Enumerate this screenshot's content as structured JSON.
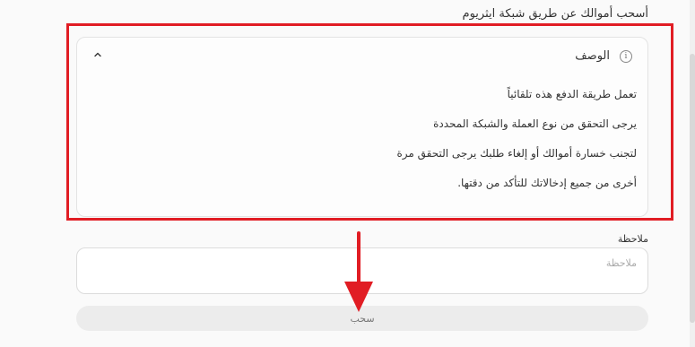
{
  "heading": "أسحب أموالك عن طريق شبكة ايثريوم",
  "description": {
    "title": "الوصف",
    "info_icon": "info-icon",
    "collapse_icon": "chevron-up-icon",
    "lines": [
      "تعمل طريقة الدفع هذه تلقائياً",
      "يرجى التحقق من نوع العملة والشبكة المحددة",
      "لتجنب خسارة أموالك أو إلغاء طلبك يرجى التحقق مرة",
      "أخرى من جميع إدخالاتك للتأكد من دقتها."
    ]
  },
  "note": {
    "label": "ملاحظة",
    "placeholder": "ملاحظة",
    "value": ""
  },
  "withdraw_button": "سحب",
  "annotation": {
    "highlight_color": "#e11d24",
    "arrow_color": "#e11d24"
  }
}
